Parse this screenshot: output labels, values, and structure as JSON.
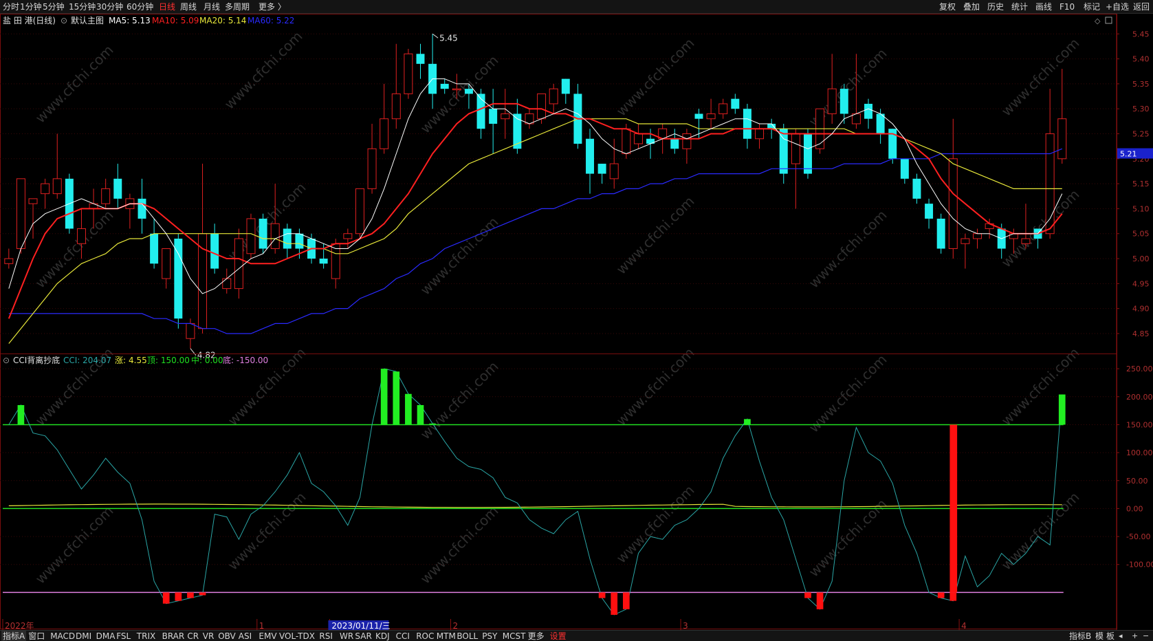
{
  "toolbar": {
    "periods": [
      "分时",
      "1分钟",
      "5分钟",
      "15分钟",
      "30分钟",
      "60分钟",
      "日线",
      "周线",
      "月线",
      "多周期",
      "更多 〉"
    ],
    "active_period": "日线",
    "right_items": [
      "复权",
      "叠加",
      "历史",
      "统计",
      "画线",
      "F10",
      "标记",
      "+自选",
      "返回"
    ]
  },
  "header": {
    "stock": "盐 田 港(日线)",
    "main_chart": "默认主图",
    "ma5": "MA5: 5.13",
    "ma10": "MA10: 5.09",
    "ma20": "MA20: 5.14",
    "ma60": "MA60: 5.22"
  },
  "indicator_header": {
    "name": "CCI背离抄底",
    "cci": "CCI: 204.07",
    "zhang_label": "涨: ",
    "zhang_value": "4.55",
    "ding": "顶: 150.00",
    "zhong": "中: 0.00",
    "di": "底: -150.00"
  },
  "annotations": {
    "high_label": "5.45",
    "low_label": "4.82",
    "current_price": "5.21"
  },
  "x_axis": {
    "labels": [
      {
        "text": "2022年",
        "bar": 0
      },
      {
        "text": "1",
        "bar": 21
      },
      {
        "text": "2023/01/11/三",
        "bar": 27
      },
      {
        "text": "2",
        "bar": 37
      },
      {
        "text": "3",
        "bar": 56
      },
      {
        "text": "4",
        "bar": 79
      }
    ],
    "highlight": "2023/01/11/三"
  },
  "bottom_tabs": [
    "指标A",
    "窗口",
    "MACD",
    "DMI",
    "DMA",
    "FSL",
    "TRIX",
    "BRAR",
    "CR",
    "VR",
    "OBV",
    "ASI",
    "EMV",
    "VOL-TDX",
    "RSI",
    "WR",
    "SAR",
    "KDJ",
    "CCI",
    "ROC",
    "MTM",
    "BOLL",
    "PSY",
    "MCST",
    "更多",
    "设置"
  ],
  "bottom_tabs_selected": "设置",
  "bottom_right": [
    "指标B",
    "模",
    "板"
  ],
  "nav_icons": [
    "left-arrow-icon",
    "plus-icon",
    "minus-icon"
  ],
  "watermark": "www.cfchi.com",
  "colors": {
    "up": "#e02020",
    "down": "#22eeee",
    "ma5": "#ffffff",
    "ma10": "#ff2020",
    "ma20": "#e8e83a",
    "ma60": "#2a2aff",
    "cci": "#2aa6a6",
    "zhang": "#e8e83a",
    "ding": "#20e020",
    "zhong": "#20e020",
    "di": "#e080e0",
    "buy_bar": "#ff1010",
    "top_bar": "#22ee22"
  },
  "chart_data": [
    {
      "type": "candlestick",
      "title": "盐 田 港(日线)",
      "y_ticks": [
        4.85,
        4.9,
        4.95,
        5.0,
        5.05,
        5.1,
        5.15,
        5.2,
        5.25,
        5.3,
        5.35,
        5.4,
        5.45
      ],
      "ylim": [
        4.81,
        5.46
      ],
      "last_price": 5.21,
      "candles": [
        [
          4.99,
          5.02,
          5.0,
          4.98
        ],
        [
          5.02,
          5.16,
          5.16,
          5.01
        ],
        [
          5.11,
          5.12,
          5.12,
          5.04
        ],
        [
          5.13,
          5.16,
          5.15,
          5.1
        ],
        [
          5.13,
          5.25,
          5.16,
          5.12
        ],
        [
          5.16,
          5.17,
          5.06,
          5.05
        ],
        [
          5.03,
          5.1,
          5.06,
          5.0
        ],
        [
          5.1,
          5.14,
          5.11,
          5.06
        ],
        [
          5.11,
          5.16,
          5.14,
          5.1
        ],
        [
          5.16,
          5.19,
          5.12,
          5.1
        ],
        [
          5.1,
          5.13,
          5.12,
          5.06
        ],
        [
          5.12,
          5.16,
          5.08,
          5.05
        ],
        [
          5.05,
          5.08,
          4.99,
          4.98
        ],
        [
          4.96,
          5.02,
          5.02,
          4.94
        ],
        [
          5.04,
          5.05,
          4.88,
          4.86
        ],
        [
          4.84,
          4.88,
          4.87,
          4.82
        ],
        [
          4.86,
          5.19,
          5.05,
          4.85
        ],
        [
          5.05,
          5.07,
          4.98,
          4.97
        ],
        [
          4.94,
          4.98,
          4.96,
          4.93
        ],
        [
          4.94,
          5.06,
          5.04,
          4.92
        ],
        [
          5.01,
          5.09,
          5.08,
          5.0
        ],
        [
          5.08,
          5.09,
          5.02,
          5.01
        ],
        [
          5.02,
          5.15,
          5.07,
          5.01
        ],
        [
          5.06,
          5.07,
          5.02,
          5.0
        ],
        [
          5.05,
          5.06,
          5.02,
          5.0
        ],
        [
          5.04,
          5.05,
          5.0,
          4.99
        ],
        [
          5.0,
          5.03,
          4.99,
          4.98
        ],
        [
          4.96,
          5.04,
          5.03,
          4.94
        ],
        [
          5.04,
          5.06,
          5.05,
          5.02
        ],
        [
          5.05,
          5.11,
          5.14,
          5.04
        ],
        [
          5.14,
          5.27,
          5.22,
          5.13
        ],
        [
          5.22,
          5.35,
          5.28,
          5.21
        ],
        [
          5.28,
          5.43,
          5.33,
          5.26
        ],
        [
          5.33,
          5.42,
          5.41,
          5.32
        ],
        [
          5.41,
          5.43,
          5.39,
          5.36
        ],
        [
          5.39,
          5.45,
          5.33,
          5.3
        ],
        [
          5.35,
          5.36,
          5.34,
          5.33
        ],
        [
          5.34,
          5.37,
          5.34,
          5.32
        ],
        [
          5.34,
          5.35,
          5.33,
          5.3
        ],
        [
          5.33,
          5.34,
          5.26,
          5.24
        ],
        [
          5.3,
          5.34,
          5.27,
          5.21
        ],
        [
          5.28,
          5.34,
          5.29,
          5.24
        ],
        [
          5.29,
          5.32,
          5.22,
          5.21
        ],
        [
          5.27,
          5.3,
          5.29,
          5.26
        ],
        [
          5.28,
          5.32,
          5.33,
          5.27
        ],
        [
          5.31,
          5.35,
          5.34,
          5.29
        ],
        [
          5.36,
          5.36,
          5.33,
          5.31
        ],
        [
          5.33,
          5.35,
          5.23,
          5.22
        ],
        [
          5.24,
          5.26,
          5.17,
          5.13
        ],
        [
          5.19,
          5.19,
          5.17,
          5.15
        ],
        [
          5.16,
          5.24,
          5.19,
          5.14
        ],
        [
          5.21,
          5.27,
          5.26,
          5.2
        ],
        [
          5.23,
          5.27,
          5.25,
          5.22
        ],
        [
          5.24,
          5.26,
          5.23,
          5.2
        ],
        [
          5.24,
          5.27,
          5.26,
          5.21
        ],
        [
          5.24,
          5.26,
          5.22,
          5.21
        ],
        [
          5.22,
          5.26,
          5.25,
          5.19
        ],
        [
          5.29,
          5.3,
          5.28,
          5.24
        ],
        [
          5.28,
          5.32,
          5.29,
          5.26
        ],
        [
          5.29,
          5.32,
          5.31,
          5.28
        ],
        [
          5.32,
          5.33,
          5.3,
          5.29
        ],
        [
          5.3,
          5.31,
          5.24,
          5.22
        ],
        [
          5.24,
          5.27,
          5.26,
          5.22
        ],
        [
          5.27,
          5.28,
          5.26,
          5.24
        ],
        [
          5.26,
          5.27,
          5.17,
          5.15
        ],
        [
          5.19,
          5.26,
          5.25,
          5.1
        ],
        [
          5.25,
          5.26,
          5.17,
          5.16
        ],
        [
          5.22,
          5.29,
          5.3,
          5.21
        ],
        [
          5.29,
          5.41,
          5.34,
          5.27
        ],
        [
          5.34,
          5.35,
          5.29,
          5.27
        ],
        [
          5.27,
          5.41,
          5.29,
          5.26
        ],
        [
          5.31,
          5.32,
          5.28,
          5.26
        ],
        [
          5.29,
          5.3,
          5.25,
          5.23
        ],
        [
          5.26,
          5.26,
          5.2,
          5.19
        ],
        [
          5.2,
          5.2,
          5.16,
          5.15
        ],
        [
          5.16,
          5.17,
          5.12,
          5.11
        ],
        [
          5.11,
          5.12,
          5.08,
          5.06
        ],
        [
          5.08,
          5.09,
          5.02,
          5.01
        ],
        [
          5.02,
          5.28,
          5.2,
          5.0
        ],
        [
          5.03,
          5.05,
          5.04,
          4.98
        ],
        [
          5.04,
          5.06,
          5.05,
          5.02
        ],
        [
          5.06,
          5.08,
          5.07,
          5.04
        ],
        [
          5.06,
          5.07,
          5.02,
          5.0
        ],
        [
          5.04,
          5.06,
          5.05,
          5.01
        ],
        [
          5.03,
          5.11,
          5.04,
          5.02
        ],
        [
          5.06,
          5.06,
          5.04,
          5.02
        ],
        [
          5.05,
          5.34,
          5.25,
          5.04
        ],
        [
          5.2,
          5.38,
          5.28,
          5.19
        ]
      ],
      "ma5": [
        4.94,
        5.02,
        5.07,
        5.09,
        5.1,
        5.11,
        5.12,
        5.11,
        5.1,
        5.1,
        5.11,
        5.11,
        5.08,
        5.05,
        5.01,
        4.96,
        4.93,
        4.94,
        4.96,
        4.98,
        5.0,
        5.01,
        5.04,
        5.05,
        5.05,
        5.04,
        5.03,
        5.02,
        5.02,
        5.04,
        5.08,
        5.14,
        5.21,
        5.28,
        5.33,
        5.36,
        5.36,
        5.35,
        5.35,
        5.32,
        5.3,
        5.3,
        5.28,
        5.27,
        5.28,
        5.29,
        5.3,
        5.29,
        5.27,
        5.24,
        5.22,
        5.21,
        5.22,
        5.23,
        5.24,
        5.25,
        5.24,
        5.25,
        5.26,
        5.27,
        5.28,
        5.28,
        5.27,
        5.27,
        5.24,
        5.23,
        5.22,
        5.23,
        5.25,
        5.28,
        5.29,
        5.3,
        5.29,
        5.27,
        5.24,
        5.19,
        5.15,
        5.11,
        5.08,
        5.06,
        5.05,
        5.05,
        5.04,
        5.05,
        5.05,
        5.05,
        5.08,
        5.13
      ],
      "ma10": [
        4.88,
        4.94,
        5.0,
        5.05,
        5.08,
        5.09,
        5.1,
        5.1,
        5.1,
        5.1,
        5.11,
        5.11,
        5.1,
        5.08,
        5.06,
        5.04,
        5.02,
        5.01,
        5.0,
        5.0,
        4.99,
        4.99,
        4.99,
        5.0,
        5.01,
        5.02,
        5.02,
        5.03,
        5.03,
        5.04,
        5.05,
        5.07,
        5.1,
        5.13,
        5.17,
        5.21,
        5.24,
        5.27,
        5.29,
        5.3,
        5.31,
        5.31,
        5.31,
        5.3,
        5.3,
        5.29,
        5.29,
        5.28,
        5.28,
        5.27,
        5.26,
        5.26,
        5.25,
        5.25,
        5.24,
        5.24,
        5.24,
        5.24,
        5.25,
        5.25,
        5.26,
        5.26,
        5.26,
        5.26,
        5.25,
        5.25,
        5.25,
        5.25,
        5.25,
        5.25,
        5.25,
        5.25,
        5.25,
        5.25,
        5.24,
        5.22,
        5.2,
        5.16,
        5.13,
        5.11,
        5.09,
        5.07,
        5.06,
        5.05,
        5.05,
        5.05,
        5.06,
        5.09
      ],
      "ma20": [
        4.83,
        4.86,
        4.89,
        4.92,
        4.95,
        4.97,
        4.99,
        5.0,
        5.01,
        5.03,
        5.04,
        5.04,
        5.05,
        5.05,
        5.05,
        5.05,
        5.05,
        5.05,
        5.05,
        5.05,
        5.05,
        5.04,
        5.04,
        5.03,
        5.03,
        5.02,
        5.02,
        5.01,
        5.01,
        5.02,
        5.03,
        5.04,
        5.06,
        5.09,
        5.11,
        5.13,
        5.15,
        5.17,
        5.19,
        5.2,
        5.21,
        5.22,
        5.23,
        5.24,
        5.25,
        5.26,
        5.27,
        5.28,
        5.28,
        5.28,
        5.28,
        5.28,
        5.27,
        5.27,
        5.27,
        5.27,
        5.27,
        5.26,
        5.26,
        5.26,
        5.26,
        5.26,
        5.26,
        5.26,
        5.26,
        5.26,
        5.26,
        5.26,
        5.26,
        5.26,
        5.25,
        5.25,
        5.25,
        5.25,
        5.24,
        5.23,
        5.22,
        5.21,
        5.19,
        5.18,
        5.17,
        5.16,
        5.15,
        5.14,
        5.14,
        5.14,
        5.14,
        5.14
      ],
      "ma60": [
        4.89,
        4.89,
        4.89,
        4.89,
        4.89,
        4.89,
        4.89,
        4.89,
        4.89,
        4.89,
        4.89,
        4.89,
        4.88,
        4.88,
        4.87,
        4.87,
        4.86,
        4.86,
        4.85,
        4.85,
        4.85,
        4.86,
        4.87,
        4.87,
        4.88,
        4.89,
        4.89,
        4.9,
        4.9,
        4.92,
        4.93,
        4.94,
        4.96,
        4.97,
        4.99,
        5.0,
        5.02,
        5.03,
        5.04,
        5.05,
        5.06,
        5.07,
        5.08,
        5.09,
        5.1,
        5.1,
        5.11,
        5.12,
        5.12,
        5.13,
        5.13,
        5.14,
        5.14,
        5.15,
        5.15,
        5.16,
        5.16,
        5.17,
        5.17,
        5.17,
        5.17,
        5.17,
        5.17,
        5.18,
        5.18,
        5.18,
        5.18,
        5.18,
        5.18,
        5.19,
        5.19,
        5.19,
        5.19,
        5.2,
        5.2,
        5.2,
        5.2,
        5.21,
        5.21,
        5.21,
        5.21,
        5.21,
        5.21,
        5.21,
        5.21,
        5.21,
        5.21,
        5.22
      ]
    },
    {
      "type": "line",
      "title": "CCI背离抄底",
      "y_ticks": [
        250,
        200,
        150,
        100,
        50,
        0,
        -50,
        -100
      ],
      "ylim": [
        -195,
        260
      ],
      "ding": 150,
      "zhong": 0,
      "di": -150,
      "cci": [
        150,
        185,
        135,
        130,
        105,
        70,
        35,
        60,
        90,
        65,
        45,
        -20,
        -130,
        -170,
        -165,
        -160,
        -155,
        -10,
        -15,
        -55,
        -10,
        5,
        30,
        60,
        100,
        45,
        30,
        5,
        -30,
        20,
        150,
        250,
        245,
        205,
        185,
        152,
        120,
        90,
        75,
        70,
        55,
        20,
        10,
        -20,
        -35,
        -45,
        -20,
        -5,
        -90,
        -160,
        -190,
        -180,
        -80,
        -50,
        -55,
        -30,
        -20,
        0,
        30,
        90,
        130,
        160,
        85,
        20,
        -20,
        -90,
        -160,
        -180,
        -130,
        50,
        145,
        100,
        85,
        45,
        -30,
        -80,
        -150,
        -160,
        -165,
        -85,
        -140,
        -120,
        -80,
        -100,
        -80,
        -50,
        -65,
        204
      ]
    }
  ]
}
